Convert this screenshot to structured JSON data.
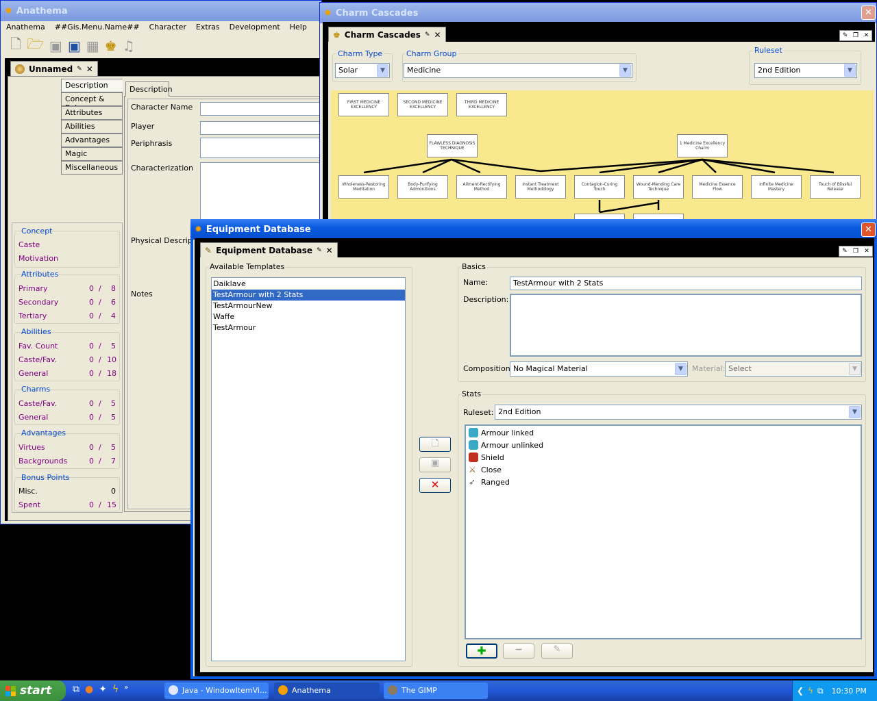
{
  "anathema": {
    "title": "Anathema",
    "menu": [
      "Anathema",
      "##Gis.Menu.Name##",
      "Character",
      "Extras",
      "Development",
      "Help"
    ],
    "doc_tab": "Unnamed",
    "side_tabs": [
      "Description",
      "Concept & Rules",
      "Attributes",
      "Abilities",
      "Advantages",
      "Magic",
      "Miscellaneous"
    ],
    "inner_tab": "Description",
    "fields": {
      "character_name": "Character Name",
      "player": "Player",
      "periphrasis": "Periphrasis",
      "characterization": "Characterization",
      "physical": "Physical Description",
      "notes": "Notes"
    },
    "summary": {
      "concept": {
        "title": "Concept",
        "rows": [
          "Caste",
          "Motivation"
        ]
      },
      "attributes": {
        "title": "Attributes",
        "rows": [
          {
            "label": "Primary",
            "value": "0",
            "max": "8"
          },
          {
            "label": "Secondary",
            "value": "0",
            "max": "6"
          },
          {
            "label": "Tertiary",
            "value": "0",
            "max": "4"
          }
        ]
      },
      "abilities": {
        "title": "Abilities",
        "rows": [
          {
            "label": "Fav. Count",
            "value": "0",
            "max": "5"
          },
          {
            "label": "Caste/Fav.",
            "value": "0",
            "max": "10"
          },
          {
            "label": "General",
            "value": "0",
            "max": "18"
          }
        ]
      },
      "charms": {
        "title": "Charms",
        "rows": [
          {
            "label": "Caste/Fav.",
            "value": "0",
            "max": "5"
          },
          {
            "label": "General",
            "value": "0",
            "max": "5"
          }
        ]
      },
      "advantages": {
        "title": "Advantages",
        "rows": [
          {
            "label": "Virtues",
            "value": "0",
            "max": "5"
          },
          {
            "label": "Backgrounds",
            "value": "0",
            "max": "7"
          }
        ]
      },
      "bonus": {
        "title": "Bonus Points",
        "rows": [
          {
            "label": "Misc.",
            "value": "0"
          },
          {
            "label": "Spent",
            "value": "0",
            "max": "15"
          }
        ]
      }
    }
  },
  "cascades": {
    "title": "Charm Cascades",
    "tab": "Charm Cascades",
    "charm_type_label": "Charm Type",
    "charm_type": "Solar",
    "charm_group_label": "Charm Group",
    "charm_group": "Medicine",
    "ruleset_label": "Ruleset",
    "ruleset": "2nd Edition",
    "nodes": {
      "n1": "FIRST MEDICINE EXCELLENCY",
      "n2": "SECOND MEDICINE EXCELLENCY",
      "n3": "THIRD MEDICINE EXCELLENCY",
      "n4": "FLAWLESS DIAGNOSIS TECHNIQUE",
      "n5": "1 Medicine Excellency Charm",
      "c1": "Wholeness-Restoring Meditation",
      "c2": "Body-Purifying Admonitions",
      "c3": "Ailment-Rectifying Method",
      "c4": "Instant Treatment Methodology",
      "c5": "Contagion-Curing Touch",
      "c6": "Wound-Mending Care Technique",
      "c7": "Medicine Essence Flow",
      "c8": "Infinite Medicine Mastery",
      "c9": "Touch of Blissful Release"
    }
  },
  "equipment": {
    "title": "Equipment Database",
    "tab": "Equipment Database",
    "templates_label": "Available Templates",
    "templates": [
      "Daiklave",
      "TestArmour with 2 Stats",
      "TestArmourNew",
      "Waffe",
      "TestArmour"
    ],
    "basics_label": "Basics",
    "name_label": "Name:",
    "name_value": "TestArmour with 2 Stats",
    "description_label": "Description:",
    "composition_label": "Composition:",
    "composition": "No Magical Material",
    "material_label": "Material:",
    "material": "Select",
    "stats_label": "Stats",
    "ruleset_label": "Ruleset:",
    "ruleset": "2nd Edition",
    "stats": [
      "Armour linked",
      "Armour unlinked",
      "Shield",
      "Close",
      "Ranged"
    ]
  },
  "taskbar": {
    "start": "start",
    "tasks": [
      "Java - WindowItemVi...",
      "Anathema",
      "The GIMP"
    ],
    "clock": "10:30 PM"
  },
  "colors": {
    "title_active": "#0a5ae0",
    "selection": "#316ac5",
    "purple_text": "#800080",
    "link_blue": "#0046d5",
    "cascade_bg": "#f8e98f"
  }
}
